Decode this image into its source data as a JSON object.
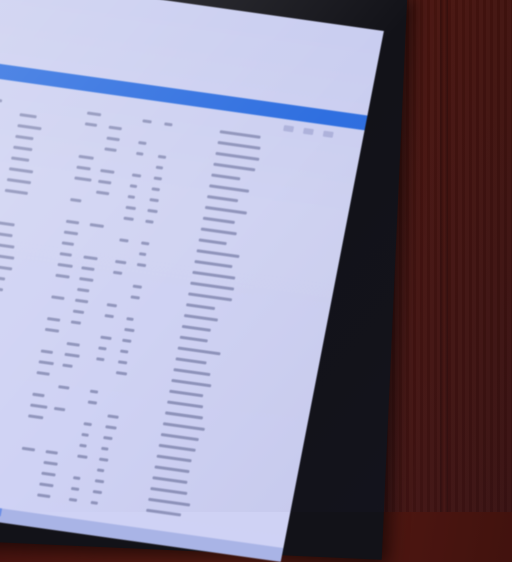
{
  "photo": {
    "subject": "",
    "colors": {
      "wall": "#4a1410",
      "bezel": "#121218",
      "screen": "#c9cdf0",
      "accent": "#2f6fe0"
    }
  },
  "app": {
    "top_menu": [
      "",
      "",
      "",
      "",
      ""
    ],
    "header_title": ""
  }
}
